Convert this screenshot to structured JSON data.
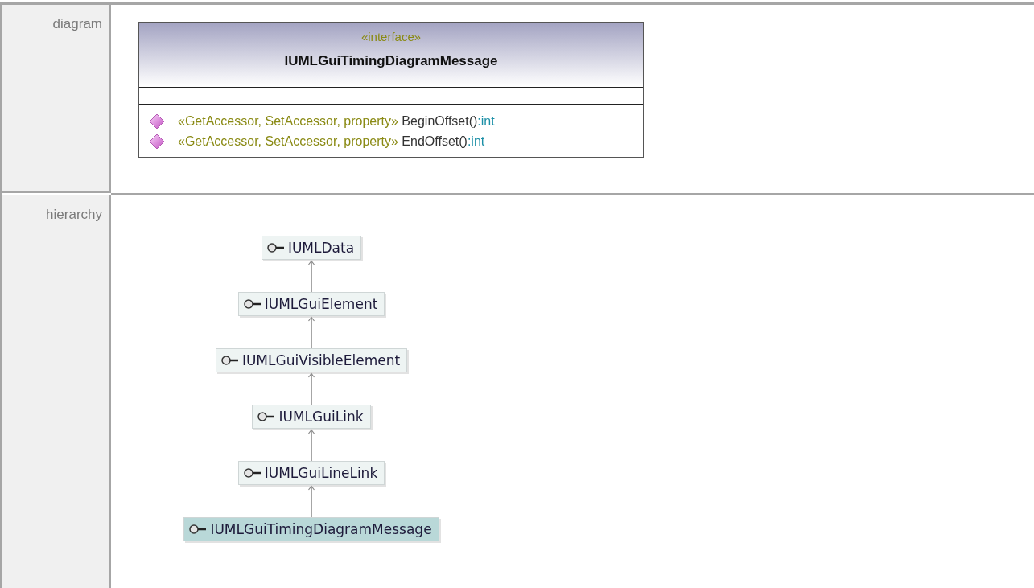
{
  "sections": [
    {
      "label": "diagram",
      "kind": "diagram"
    },
    {
      "label": "hierarchy",
      "kind": "hierarchy"
    }
  ],
  "class_box": {
    "stereotype": "«interface»",
    "name": "IUMLGuiTimingDiagramMessage",
    "members": [
      {
        "stereotype": "«GetAccessor, SetAccessor, property»",
        "name": "BeginOffset()",
        "type": ":int"
      },
      {
        "stereotype": "«GetAccessor, SetAccessor, property»",
        "name": "EndOffset()",
        "type": ":int"
      }
    ]
  },
  "hierarchy": [
    {
      "name": "IUMLData",
      "selected": false
    },
    {
      "name": "IUMLGuiElement",
      "selected": false
    },
    {
      "name": "IUMLGuiVisibleElement",
      "selected": false
    },
    {
      "name": "IUMLGuiLink",
      "selected": false
    },
    {
      "name": "IUMLGuiLineLink",
      "selected": false
    },
    {
      "name": "IUMLGuiTimingDiagramMessage",
      "selected": true
    }
  ]
}
